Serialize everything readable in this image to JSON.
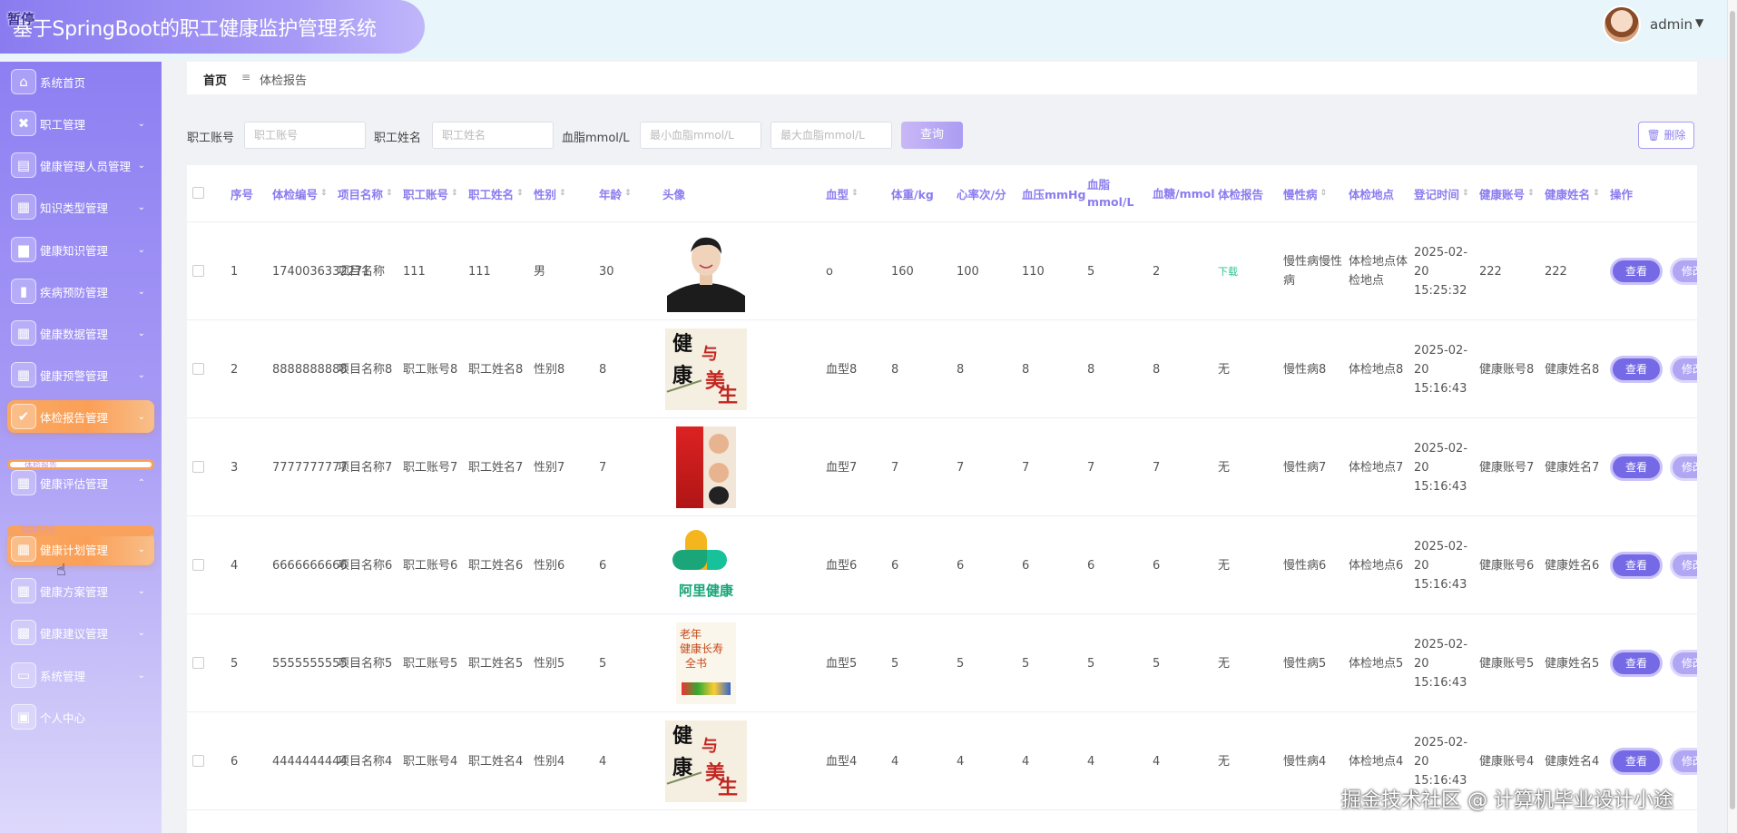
{
  "header": {
    "title": "基于SpringBoot的职工健康监护管理系统",
    "pause_tag": "暂停",
    "user_name": "admin",
    "user_caret": "▼",
    "accent": "#8a7cf0"
  },
  "sidebar": {
    "items": [
      {
        "label": "系统首页",
        "icon": "home-icon",
        "glyph": "⌂",
        "caret": ""
      },
      {
        "label": "职工管理",
        "icon": "document-x-icon",
        "glyph": "✖",
        "caret": "⌄"
      },
      {
        "label": "健康管理人员管理",
        "icon": "briefcase-icon",
        "glyph": "▤",
        "caret": "⌄"
      },
      {
        "label": "知识类型管理",
        "icon": "grid-icon",
        "glyph": "▦",
        "caret": "⌄"
      },
      {
        "label": "健康知识管理",
        "icon": "board-icon",
        "glyph": "▆",
        "caret": "⌄"
      },
      {
        "label": "疾病预防管理",
        "icon": "bar-chart-icon",
        "glyph": "▮",
        "caret": "⌄"
      },
      {
        "label": "健康数据管理",
        "icon": "grid-icon",
        "glyph": "▦",
        "caret": "⌄"
      },
      {
        "label": "健康预警管理",
        "icon": "grid-icon",
        "glyph": "▦",
        "caret": "⌄"
      },
      {
        "label": "体检报告管理",
        "icon": "clipboard-check-icon",
        "glyph": "✔",
        "caret": "⌄"
      },
      {
        "label": "健康评估管理",
        "icon": "grid-icon",
        "glyph": "▦",
        "caret": "⌃"
      },
      {
        "label": "健康计划管理",
        "icon": "grid-icon",
        "glyph": "▦",
        "caret": "⌄"
      },
      {
        "label": "健康方案管理",
        "icon": "grid-icon",
        "glyph": "▦",
        "caret": "⌄"
      },
      {
        "label": "健康建议管理",
        "icon": "grid-small-icon",
        "glyph": "▩",
        "caret": "⌄"
      },
      {
        "label": "系统管理",
        "icon": "monitor-icon",
        "glyph": "▭",
        "caret": "⌄"
      },
      {
        "label": "个人中心",
        "icon": "wallet-icon",
        "glyph": "▣",
        "caret": ""
      }
    ],
    "sub_strips": [
      "体检报告",
      "健康评估"
    ]
  },
  "breadcrumb": {
    "home": "首页",
    "separator": "≡",
    "current": "体检报告"
  },
  "search": {
    "account_label": "职工账号",
    "account_placeholder": "职工账号",
    "name_label": "职工姓名",
    "name_placeholder": "职工姓名",
    "lipid_label": "血脂mmol/L",
    "min_placeholder": "最小血脂mmol/L",
    "max_placeholder": "最大血脂mmol/L",
    "query_button": "查询",
    "delete_button": "🗑 删除"
  },
  "table": {
    "columns": [
      "序号",
      "体检编号",
      "项目名称",
      "职工账号",
      "职工姓名",
      "性别",
      "年龄",
      "头像",
      "血型",
      "体重/kg",
      "心率次/分",
      "血压mmHg",
      "血脂mmol/L",
      "血糖/mmol",
      "体检报告",
      "慢性病",
      "体检地点",
      "登记时间",
      "健康账号",
      "健康姓名",
      "操作"
    ],
    "view_label": "查看",
    "edit_label": "修改",
    "rows": [
      {
        "idx": "1",
        "code": "1740036332271",
        "project": "项目名称",
        "account": "111",
        "name": "111",
        "gender": "男",
        "age": "30",
        "avatar": "portrait",
        "blood": "o",
        "weight": "160",
        "heart": "100",
        "pressure": "110",
        "lipid": "5",
        "sugar": "2",
        "report": "下载",
        "chronic": "慢性病慢性病",
        "place": "体检地点体检地点",
        "time": "2025-02-20 15:25:32",
        "h_account": "222",
        "h_name": "222"
      },
      {
        "idx": "2",
        "code": "8888888888",
        "project": "项目名称8",
        "account": "职工账号8",
        "name": "职工姓名8",
        "gender": "性别8",
        "age": "8",
        "avatar": "book-health",
        "blood": "血型8",
        "weight": "8",
        "heart": "8",
        "pressure": "8",
        "lipid": "8",
        "sugar": "8",
        "report": "无",
        "chronic": "慢性病8",
        "place": "体检地点8",
        "time": "2025-02-20 15:16:43",
        "h_account": "健康账号8",
        "h_name": "健康姓名8"
      },
      {
        "idx": "3",
        "code": "7777777777",
        "project": "项目名称7",
        "account": "职工账号7",
        "name": "职工姓名7",
        "gender": "性别7",
        "age": "7",
        "avatar": "book-red",
        "blood": "血型7",
        "weight": "7",
        "heart": "7",
        "pressure": "7",
        "lipid": "7",
        "sugar": "7",
        "report": "无",
        "chronic": "慢性病7",
        "place": "体检地点7",
        "time": "2025-02-20 15:16:43",
        "h_account": "健康账号7",
        "h_name": "健康姓名7"
      },
      {
        "idx": "4",
        "code": "6666666666",
        "project": "项目名称6",
        "account": "职工账号6",
        "name": "职工姓名6",
        "gender": "性别6",
        "age": "6",
        "avatar": "ali-logo",
        "blood": "血型6",
        "weight": "6",
        "heart": "6",
        "pressure": "6",
        "lipid": "6",
        "sugar": "6",
        "report": "无",
        "chronic": "慢性病6",
        "place": "体检地点6",
        "time": "2025-02-20 15:16:43",
        "h_account": "健康账号6",
        "h_name": "健康姓名6"
      },
      {
        "idx": "5",
        "code": "5555555555",
        "project": "项目名称5",
        "account": "职工账号5",
        "name": "职工姓名5",
        "gender": "性别5",
        "age": "5",
        "avatar": "book-elder",
        "blood": "血型5",
        "weight": "5",
        "heart": "5",
        "pressure": "5",
        "lipid": "5",
        "sugar": "5",
        "report": "无",
        "chronic": "慢性病5",
        "place": "体检地点5",
        "time": "2025-02-20 15:16:43",
        "h_account": "健康账号5",
        "h_name": "健康姓名5"
      },
      {
        "idx": "6",
        "code": "4444444444",
        "project": "项目名称4",
        "account": "职工账号4",
        "name": "职工姓名4",
        "gender": "性别4",
        "age": "4",
        "avatar": "book-health",
        "blood": "血型4",
        "weight": "4",
        "heart": "4",
        "pressure": "4",
        "lipid": "4",
        "sugar": "4",
        "report": "无",
        "chronic": "慢性病4",
        "place": "体检地点4",
        "time": "2025-02-20 15:16:43",
        "h_account": "健康账号4",
        "h_name": "健康姓名4"
      }
    ]
  },
  "thumb_text": {
    "book_health": [
      "健",
      "康",
      "与",
      "美",
      "生"
    ],
    "ali_logo": "阿里健康",
    "book_elder": [
      "老年",
      "健康长寿",
      "全书"
    ]
  },
  "watermark": "掘金技术社区 @ 计算机毕业设计小途"
}
